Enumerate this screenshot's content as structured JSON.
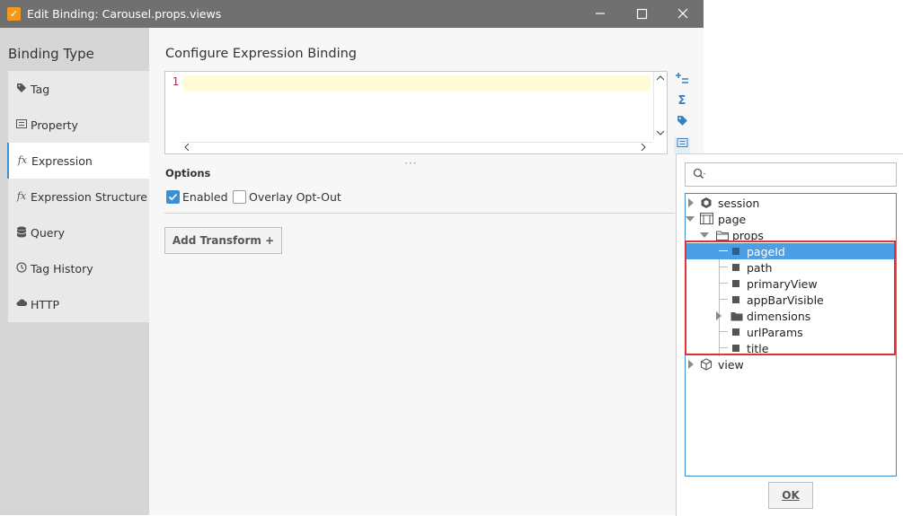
{
  "window": {
    "title": "Edit Binding: Carousel.props.views",
    "icon": "ignition-icon",
    "controls": [
      "minimize-icon",
      "maximize-icon",
      "close-icon"
    ]
  },
  "sidebar": {
    "title": "Binding Type",
    "items": [
      {
        "label": "Tag",
        "icon": "tag-icon"
      },
      {
        "label": "Property",
        "icon": "property-icon"
      },
      {
        "label": "Expression",
        "icon": "fx-icon",
        "active": true
      },
      {
        "label": "Expression Structure",
        "icon": "fx-icon"
      },
      {
        "label": "Query",
        "icon": "database-icon"
      },
      {
        "label": "Tag History",
        "icon": "history-icon"
      },
      {
        "label": "HTTP",
        "icon": "cloud-icon"
      }
    ],
    "fx_glyph": "fx"
  },
  "main": {
    "title": "Configure Expression Binding",
    "editor": {
      "line_number": "1",
      "content": ""
    },
    "splitter": "···",
    "options_title": "Options",
    "enabled_label": "Enabled",
    "enabled_checked": true,
    "overlay_label": "Overlay Opt-Out",
    "overlay_checked": false,
    "add_transform_label": "Add Transform +"
  },
  "toolbar": {
    "icons": [
      "insert-function-icon",
      "sigma-icon",
      "tag-icon",
      "property-browser-icon"
    ],
    "glyphs": [
      "+=",
      "Σ",
      "",
      "≡"
    ]
  },
  "property_browser": {
    "search_placeholder": "",
    "tree": {
      "session": "session",
      "page": "page",
      "props": "props",
      "pageId": "pageId",
      "path": "path",
      "primaryView": "primaryView",
      "appBarVisible": "appBarVisible",
      "dimensions": "dimensions",
      "urlParams": "urlParams",
      "title": "title",
      "view": "view"
    },
    "selected": "pageId",
    "ok_label": "OK"
  },
  "colors": {
    "accent": "#3d8fd1",
    "selection": "#4a9fe6",
    "highlight_border": "#e0303c",
    "titlebar": "#707070",
    "brand": "#f39a1d"
  }
}
